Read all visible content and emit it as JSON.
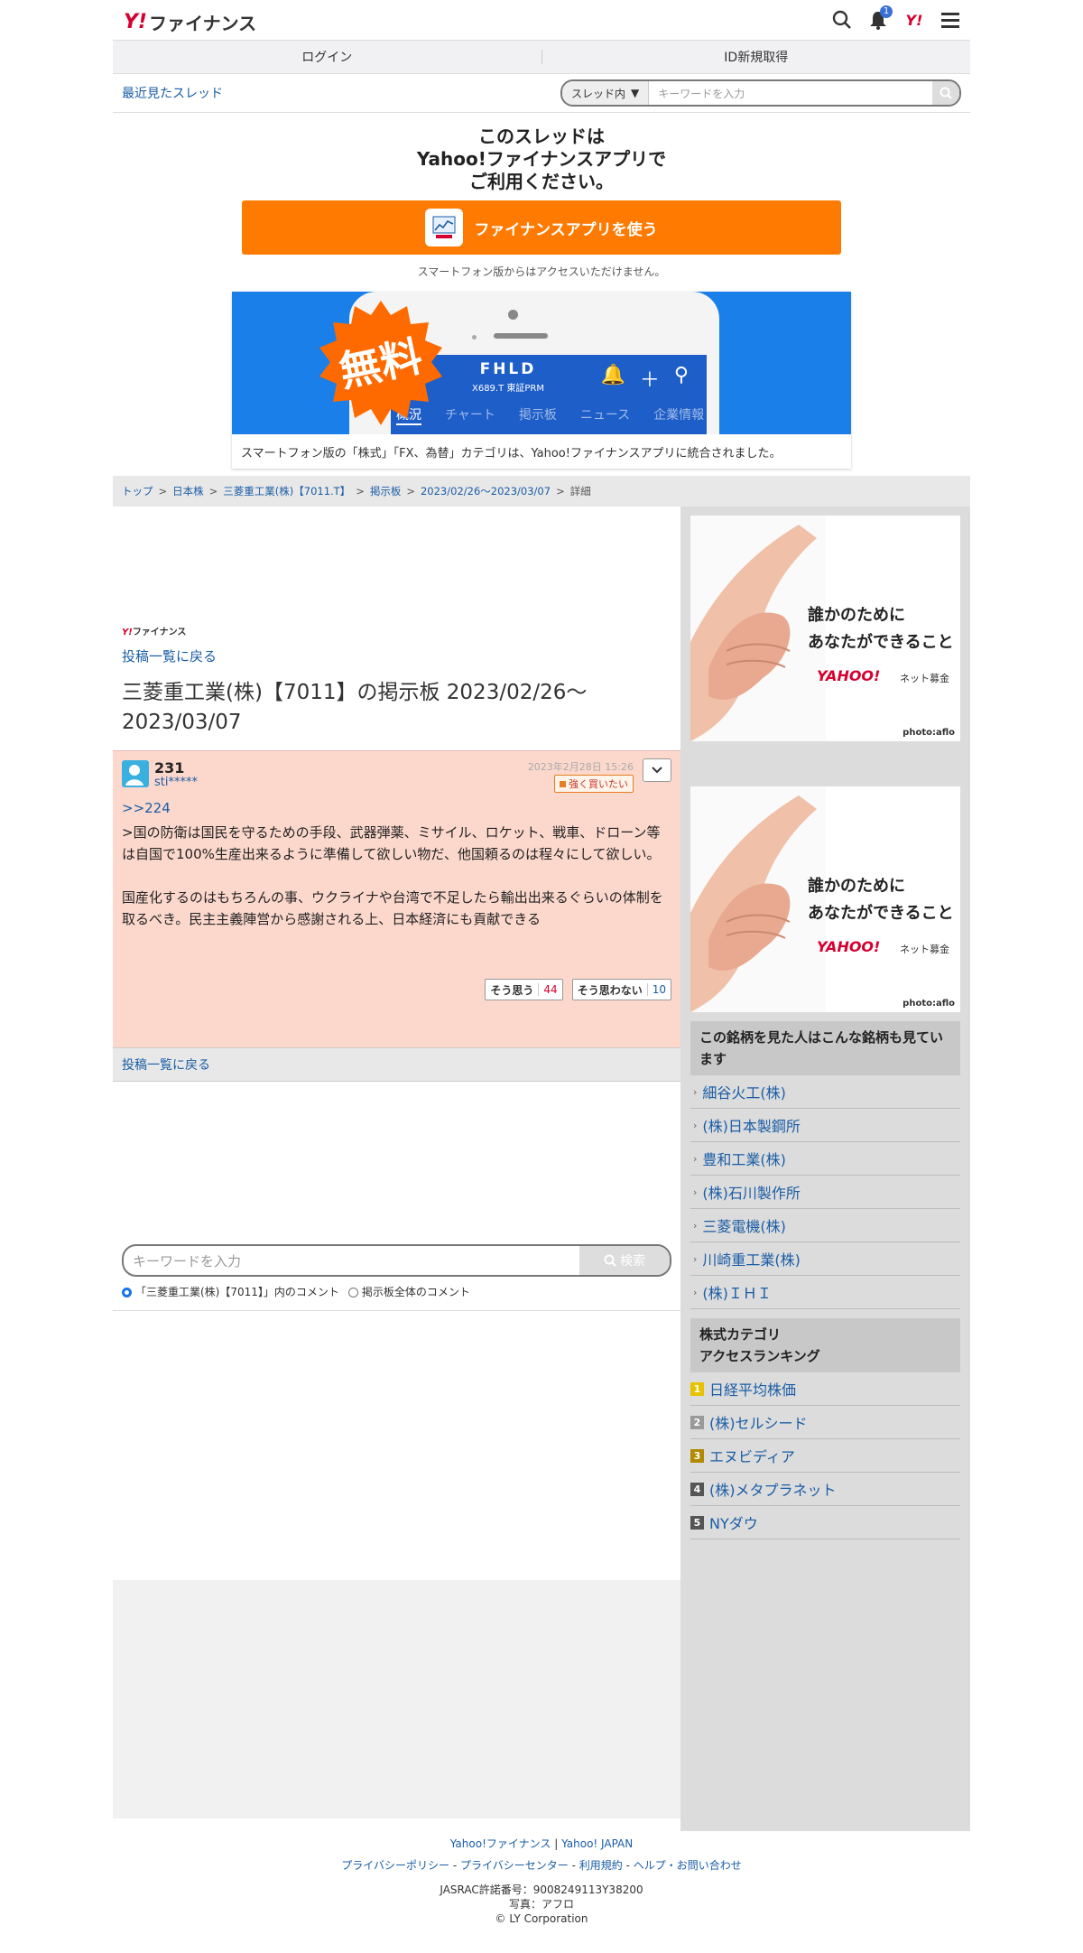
{
  "header": {
    "logo_text": "ファイナンス",
    "logo_y": "Y!",
    "notification_count": "1",
    "brand": "Y!"
  },
  "auth": {
    "login": "ログイン",
    "signup": "ID新規取得"
  },
  "thread_search": {
    "recent_label": "最近見たスレッド",
    "scope": "スレッド内",
    "placeholder": "キーワードを入力"
  },
  "promo": {
    "line1": "このスレッドは",
    "line2": "Yahoo!ファイナンスアプリで",
    "line3": "ご利用ください。",
    "button": "ファイナンスアプリを使う",
    "note": "スマートフォン版からはアクセスいただけません。",
    "banner_free": "無料",
    "banner_code": "FHLD",
    "banner_sub": "X689.T 東証PRM",
    "banner_tabs": [
      "概況",
      "チャート",
      "掲示板",
      "ニュース",
      "企業情報"
    ],
    "banner_caption": "スマートフォン版の「株式」「FX、為替」カテゴリは、Yahoo!ファイナンスアプリに統合されました。"
  },
  "breadcrumb": [
    "トップ",
    "日本株",
    "三菱重工業(株)【7011.T】",
    "掲示板",
    "2023/02/26〜2023/03/07",
    "詳細"
  ],
  "main": {
    "small_logo": "Y!ファイナンス",
    "back_link": "投稿一覧に戻る",
    "title": "三菱重工業(株)【7011】の掲示板 2023/02/26〜2023/03/07",
    "post": {
      "number": "231",
      "user": "sti*****",
      "date": "2023年2月28日 15:26",
      "sentiment": "強く買いたい",
      "reply_ref": ">>224",
      "body1": ">国の防衛は国民を守るための手段、武器弾薬、ミサイル、ロケット、戦車、ドローン等は自国で100%生産出来るように準備して欲しい物だ、他国頼るのは程々にして欲しい。",
      "body2": "国産化するのはもちろんの事、ウクライナや台湾で不足したら輸出出来るぐらいの体制を取るべき。民主主義陣営から感謝される上、日本経済にも貢献できる",
      "agree_label": "そう思う",
      "agree_count": "44",
      "disagree_label": "そう思わない",
      "disagree_count": "10"
    },
    "back_link2": "投稿一覧に戻る",
    "search_placeholder": "キーワードを入力",
    "search_button": "検索",
    "radio1": "「三菱重工業(株)【7011】」内のコメント",
    "radio2": "掲示板全体のコメント"
  },
  "side": {
    "ad_line1": "誰かのために",
    "ad_line2": "あなたができること",
    "ad_brand": "YAHOO!",
    "ad_brand_sub": "ネット募金",
    "ad_credit": "photo:aflo",
    "related_title": "この銘柄を見た人はこんな銘柄も見ています",
    "related": [
      "細谷火工(株)",
      "(株)日本製鋼所",
      "豊和工業(株)",
      "(株)石川製作所",
      "三菱電機(株)",
      "川崎重工業(株)",
      "(株)ＩＨＩ"
    ],
    "ranking_title1": "株式カテゴリ",
    "ranking_title2": "アクセスランキング",
    "ranking": [
      {
        "rank": "1",
        "name": "日経平均株価",
        "color": "#e8c200"
      },
      {
        "rank": "2",
        "name": "(株)セルシード",
        "color": "#999999"
      },
      {
        "rank": "3",
        "name": "エヌビディア",
        "color": "#b08a00"
      },
      {
        "rank": "4",
        "name": "(株)メタプラネット",
        "color": "#555555"
      },
      {
        "rank": "5",
        "name": "NYダウ",
        "color": "#555555"
      }
    ]
  },
  "footer": {
    "link1": "Yahoo!ファイナンス",
    "link2": "Yahoo! JAPAN",
    "links": [
      "プライバシーポリシー",
      "プライバシーセンター",
      "利用規約",
      "ヘルプ・お問い合わせ"
    ],
    "jasrac": "JASRAC許諾番号：9008249113Y38200",
    "photo": "写真：アフロ",
    "copyright": "© LY Corporation"
  }
}
